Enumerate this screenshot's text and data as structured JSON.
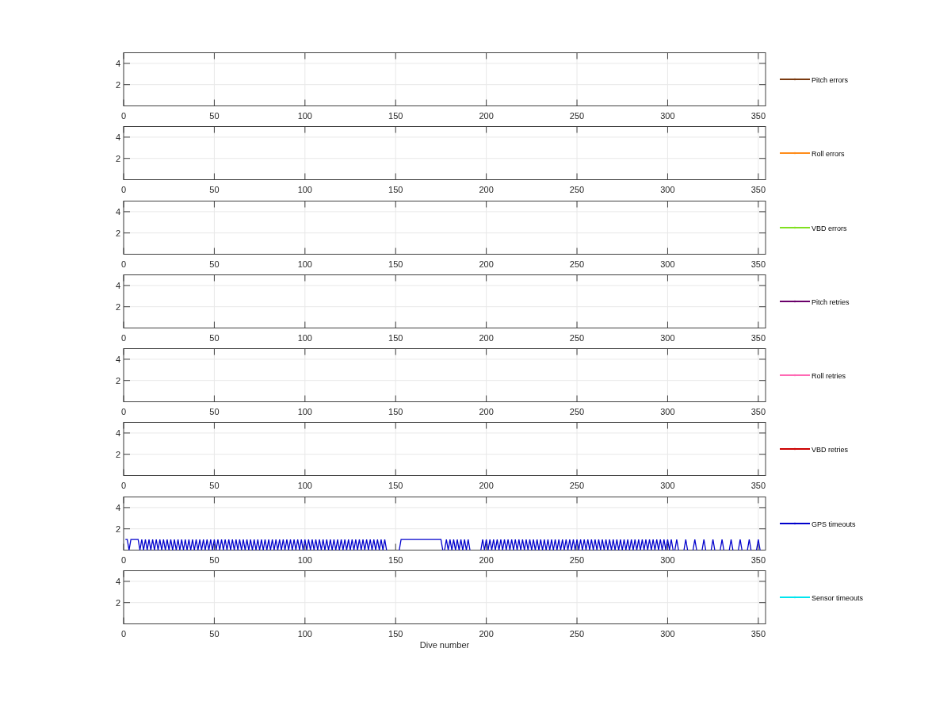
{
  "figure": {
    "subplots": [
      {
        "grid": true,
        "x_tick_labels": [
          "0",
          "50",
          "100",
          "150",
          "200",
          "250",
          "300",
          "350"
        ],
        "y_tick_labels": [
          "4",
          "2"
        ],
        "legend": {
          "name": "Pitch errors",
          "color": "#7a3a10"
        }
      },
      {
        "grid": true,
        "x_tick_labels": [
          "0",
          "50",
          "100",
          "150",
          "200",
          "250",
          "300",
          "350"
        ],
        "y_tick_labels": [
          "4",
          "2"
        ],
        "legend": {
          "name": "Roll errors",
          "color": "#ff8c1a"
        }
      },
      {
        "grid": true,
        "x_tick_labels": [
          "0",
          "50",
          "100",
          "150",
          "200",
          "250",
          "300",
          "350"
        ],
        "y_tick_labels": [
          "4",
          "2"
        ],
        "legend": {
          "name": "VBD errors",
          "color": "#80e020"
        }
      },
      {
        "grid": true,
        "x_tick_labels": [
          "0",
          "50",
          "100",
          "150",
          "200",
          "250",
          "300",
          "350"
        ],
        "y_tick_labels": [
          "4",
          "2"
        ],
        "legend": {
          "name": "Pitch retries",
          "color": "#6a006a"
        }
      },
      {
        "grid": true,
        "x_tick_labels": [
          "0",
          "50",
          "100",
          "150",
          "200",
          "250",
          "300",
          "350"
        ],
        "y_tick_labels": [
          "4",
          "2"
        ],
        "legend": {
          "name": "Roll retries",
          "color": "#ff69b4"
        }
      },
      {
        "grid": true,
        "x_tick_labels": [
          "0",
          "50",
          "100",
          "150",
          "200",
          "250",
          "300",
          "350"
        ],
        "y_tick_labels": [
          "4",
          "2"
        ],
        "legend": {
          "name": "VBD retries",
          "color": "#cc0000"
        }
      },
      {
        "chart_data": {
          "type": "line",
          "xlim": [
            0,
            354
          ],
          "ylim": [
            0,
            5
          ],
          "xticks": [
            0,
            50,
            100,
            150,
            200,
            250,
            300,
            350
          ],
          "yticks": [
            2,
            4
          ],
          "grid": true,
          "x": [
            1,
            2,
            3,
            4,
            5,
            6,
            7,
            8,
            9,
            10,
            11,
            12,
            13,
            14,
            15,
            16,
            17,
            18,
            19,
            20,
            21,
            22,
            23,
            24,
            25,
            26,
            27,
            28,
            29,
            30,
            31,
            32,
            33,
            34,
            35,
            36,
            37,
            38,
            39,
            40,
            41,
            42,
            43,
            44,
            45,
            46,
            47,
            48,
            49,
            50,
            51,
            52,
            53,
            54,
            55,
            56,
            57,
            58,
            59,
            60,
            61,
            62,
            63,
            64,
            65,
            66,
            67,
            68,
            69,
            70,
            71,
            72,
            73,
            74,
            75,
            76,
            77,
            78,
            79,
            80,
            81,
            82,
            83,
            84,
            85,
            86,
            87,
            88,
            89,
            90,
            91,
            92,
            93,
            94,
            95,
            96,
            97,
            98,
            99,
            100,
            101,
            102,
            103,
            104,
            105,
            106,
            107,
            108,
            109,
            110,
            111,
            112,
            113,
            114,
            115,
            116,
            117,
            118,
            119,
            120,
            121,
            122,
            123,
            124,
            125,
            126,
            127,
            128,
            129,
            130,
            131,
            132,
            133,
            134,
            135,
            136,
            137,
            138,
            139,
            140,
            141,
            142,
            143,
            144,
            145,
            152,
            153,
            154,
            155,
            156,
            157,
            158,
            159,
            160,
            161,
            162,
            163,
            164,
            165,
            166,
            167,
            168,
            169,
            170,
            171,
            172,
            173,
            174,
            175,
            176,
            177,
            178,
            179,
            180,
            181,
            182,
            183,
            184,
            185,
            186,
            187,
            188,
            189,
            190,
            191,
            197,
            198,
            199,
            200,
            201,
            202,
            203,
            204,
            205,
            206,
            207,
            208,
            209,
            210,
            211,
            212,
            213,
            214,
            215,
            216,
            217,
            218,
            219,
            220,
            221,
            222,
            223,
            224,
            225,
            226,
            227,
            228,
            229,
            230,
            231,
            232,
            233,
            234,
            235,
            236,
            237,
            238,
            239,
            240,
            241,
            242,
            243,
            244,
            245,
            246,
            247,
            248,
            249,
            250,
            251,
            252,
            253,
            254,
            255,
            256,
            257,
            258,
            259,
            260,
            261,
            262,
            263,
            264,
            265,
            266,
            267,
            268,
            269,
            270,
            271,
            272,
            273,
            274,
            275,
            276,
            277,
            278,
            279,
            280,
            281,
            282,
            283,
            284,
            285,
            286,
            287,
            288,
            289,
            290,
            291,
            292,
            293,
            294,
            295,
            296,
            297,
            298,
            299,
            300,
            301,
            302,
            303,
            304,
            305,
            306,
            309,
            310,
            311,
            314,
            315,
            316,
            319,
            320,
            321,
            324,
            325,
            326,
            329,
            330,
            331,
            334,
            335,
            336,
            339,
            340,
            341,
            344,
            345,
            346,
            349,
            350,
            351
          ],
          "series": [
            {
              "name": "GPS timeouts",
              "color": "#0000cc",
              "values": [
                1,
                1,
                0,
                1,
                1,
                1,
                1,
                1,
                0,
                1,
                0,
                1,
                0,
                1,
                0,
                1,
                0,
                1,
                0,
                1,
                0,
                1,
                0,
                1,
                0,
                1,
                0,
                1,
                0,
                1,
                0,
                1,
                0,
                1,
                0,
                1,
                0,
                1,
                0,
                1,
                0,
                1,
                0,
                1,
                0,
                1,
                0,
                1,
                0,
                1,
                0,
                1,
                0,
                1,
                0,
                1,
                0,
                1,
                0,
                1,
                0,
                1,
                0,
                1,
                0,
                1,
                0,
                1,
                0,
                1,
                0,
                1,
                0,
                1,
                0,
                1,
                0,
                1,
                0,
                1,
                0,
                1,
                0,
                1,
                0,
                1,
                0,
                1,
                0,
                1,
                0,
                1,
                0,
                1,
                0,
                1,
                0,
                1,
                0,
                1,
                0,
                1,
                0,
                1,
                0,
                1,
                0,
                1,
                0,
                1,
                0,
                1,
                0,
                1,
                0,
                1,
                0,
                1,
                0,
                1,
                0,
                1,
                0,
                1,
                0,
                1,
                0,
                1,
                0,
                1,
                0,
                1,
                0,
                1,
                0,
                1,
                0,
                1,
                0,
                1,
                0,
                1,
                0,
                1,
                0,
                0,
                1,
                1,
                1,
                1,
                1,
                1,
                1,
                1,
                1,
                1,
                1,
                1,
                1,
                1,
                1,
                1,
                1,
                1,
                1,
                1,
                1,
                1,
                1,
                0,
                0,
                1,
                0,
                1,
                0,
                1,
                0,
                1,
                0,
                1,
                0,
                1,
                0,
                1,
                0,
                0,
                1,
                0,
                1,
                0,
                1,
                0,
                1,
                0,
                1,
                0,
                1,
                0,
                1,
                0,
                1,
                0,
                1,
                0,
                1,
                0,
                1,
                0,
                1,
                0,
                1,
                0,
                1,
                0,
                1,
                0,
                1,
                0,
                1,
                0,
                1,
                0,
                1,
                0,
                1,
                0,
                1,
                0,
                1,
                0,
                1,
                0,
                1,
                0,
                1,
                0,
                1,
                0,
                1,
                0,
                1,
                0,
                1,
                0,
                1,
                0,
                1,
                0,
                1,
                0,
                1,
                0,
                1,
                0,
                1,
                0,
                1,
                0,
                1,
                0,
                1,
                0,
                1,
                0,
                1,
                0,
                1,
                0,
                1,
                0,
                1,
                0,
                1,
                0,
                1,
                0,
                1,
                0,
                1,
                0,
                1,
                0,
                1,
                0,
                1,
                0,
                1,
                0,
                1,
                0,
                1,
                0,
                0,
                1,
                0,
                0,
                1,
                0,
                0,
                1,
                0,
                0,
                1,
                0,
                0,
                1,
                0,
                0,
                1,
                0,
                0,
                1,
                0,
                0,
                1,
                0,
                0,
                1,
                0,
                0,
                1,
                0
              ]
            }
          ]
        }
      },
      {
        "grid": true,
        "x_tick_labels": [
          "0",
          "50",
          "100",
          "150",
          "200",
          "250",
          "300",
          "350"
        ],
        "y_tick_labels": [
          "4",
          "2"
        ],
        "xlabel": "Dive number",
        "legend": {
          "name": "Sensor timeouts",
          "color": "#00e5ee"
        }
      }
    ]
  }
}
